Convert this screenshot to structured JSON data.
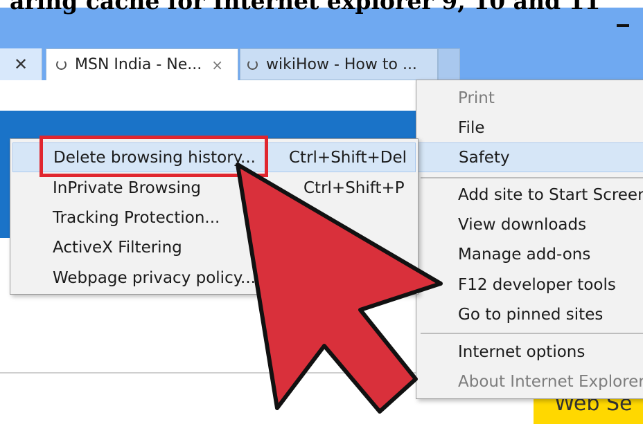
{
  "heading": "aring cache for Internet explorer 9, 10 and 11",
  "window": {
    "minimize_symbol": "–"
  },
  "tabs": {
    "close_symbol": "✕",
    "items": [
      {
        "label": "MSN India - Ne...",
        "close": "×",
        "active": true
      },
      {
        "label": "wikiHow - How to ...",
        "active": false
      }
    ]
  },
  "tools_menu": {
    "items": [
      {
        "label": "Print",
        "disabled": true
      },
      {
        "label": "File",
        "disabled": false
      },
      {
        "label": "Safety",
        "disabled": false,
        "hover": true
      },
      {
        "label": "Add site to Start Screen",
        "disabled": false
      },
      {
        "label": "View downloads",
        "disabled": false
      },
      {
        "label": "Manage add-ons",
        "disabled": false
      },
      {
        "label": "F12 developer tools",
        "disabled": false
      },
      {
        "label": "Go to pinned sites",
        "disabled": false
      },
      {
        "label": "Internet options",
        "disabled": false
      },
      {
        "label": "About Internet Explorer",
        "disabled": true
      }
    ]
  },
  "safety_menu": {
    "items": [
      {
        "label": "Delete browsing history...",
        "shortcut": "Ctrl+Shift+Del",
        "hover": true
      },
      {
        "label": "InPrivate Browsing",
        "shortcut": "Ctrl+Shift+P"
      },
      {
        "label": "Tracking Protection...",
        "shortcut": ""
      },
      {
        "label": "ActiveX Filtering",
        "shortcut": ""
      },
      {
        "label": "Webpage privacy policy...",
        "shortcut": ""
      }
    ]
  },
  "page": {
    "yellow_button_text": "Web Se"
  },
  "colors": {
    "titlebar": "#6fa9f1",
    "page_blue": "#1a73c8",
    "highlight_red": "#e0262f",
    "arrow_red": "#d9303b",
    "yellow": "#ffd800"
  },
  "icons": [
    "minimize-icon",
    "close-icon",
    "loading-spinner-icon",
    "pointer-arrow-icon"
  ]
}
